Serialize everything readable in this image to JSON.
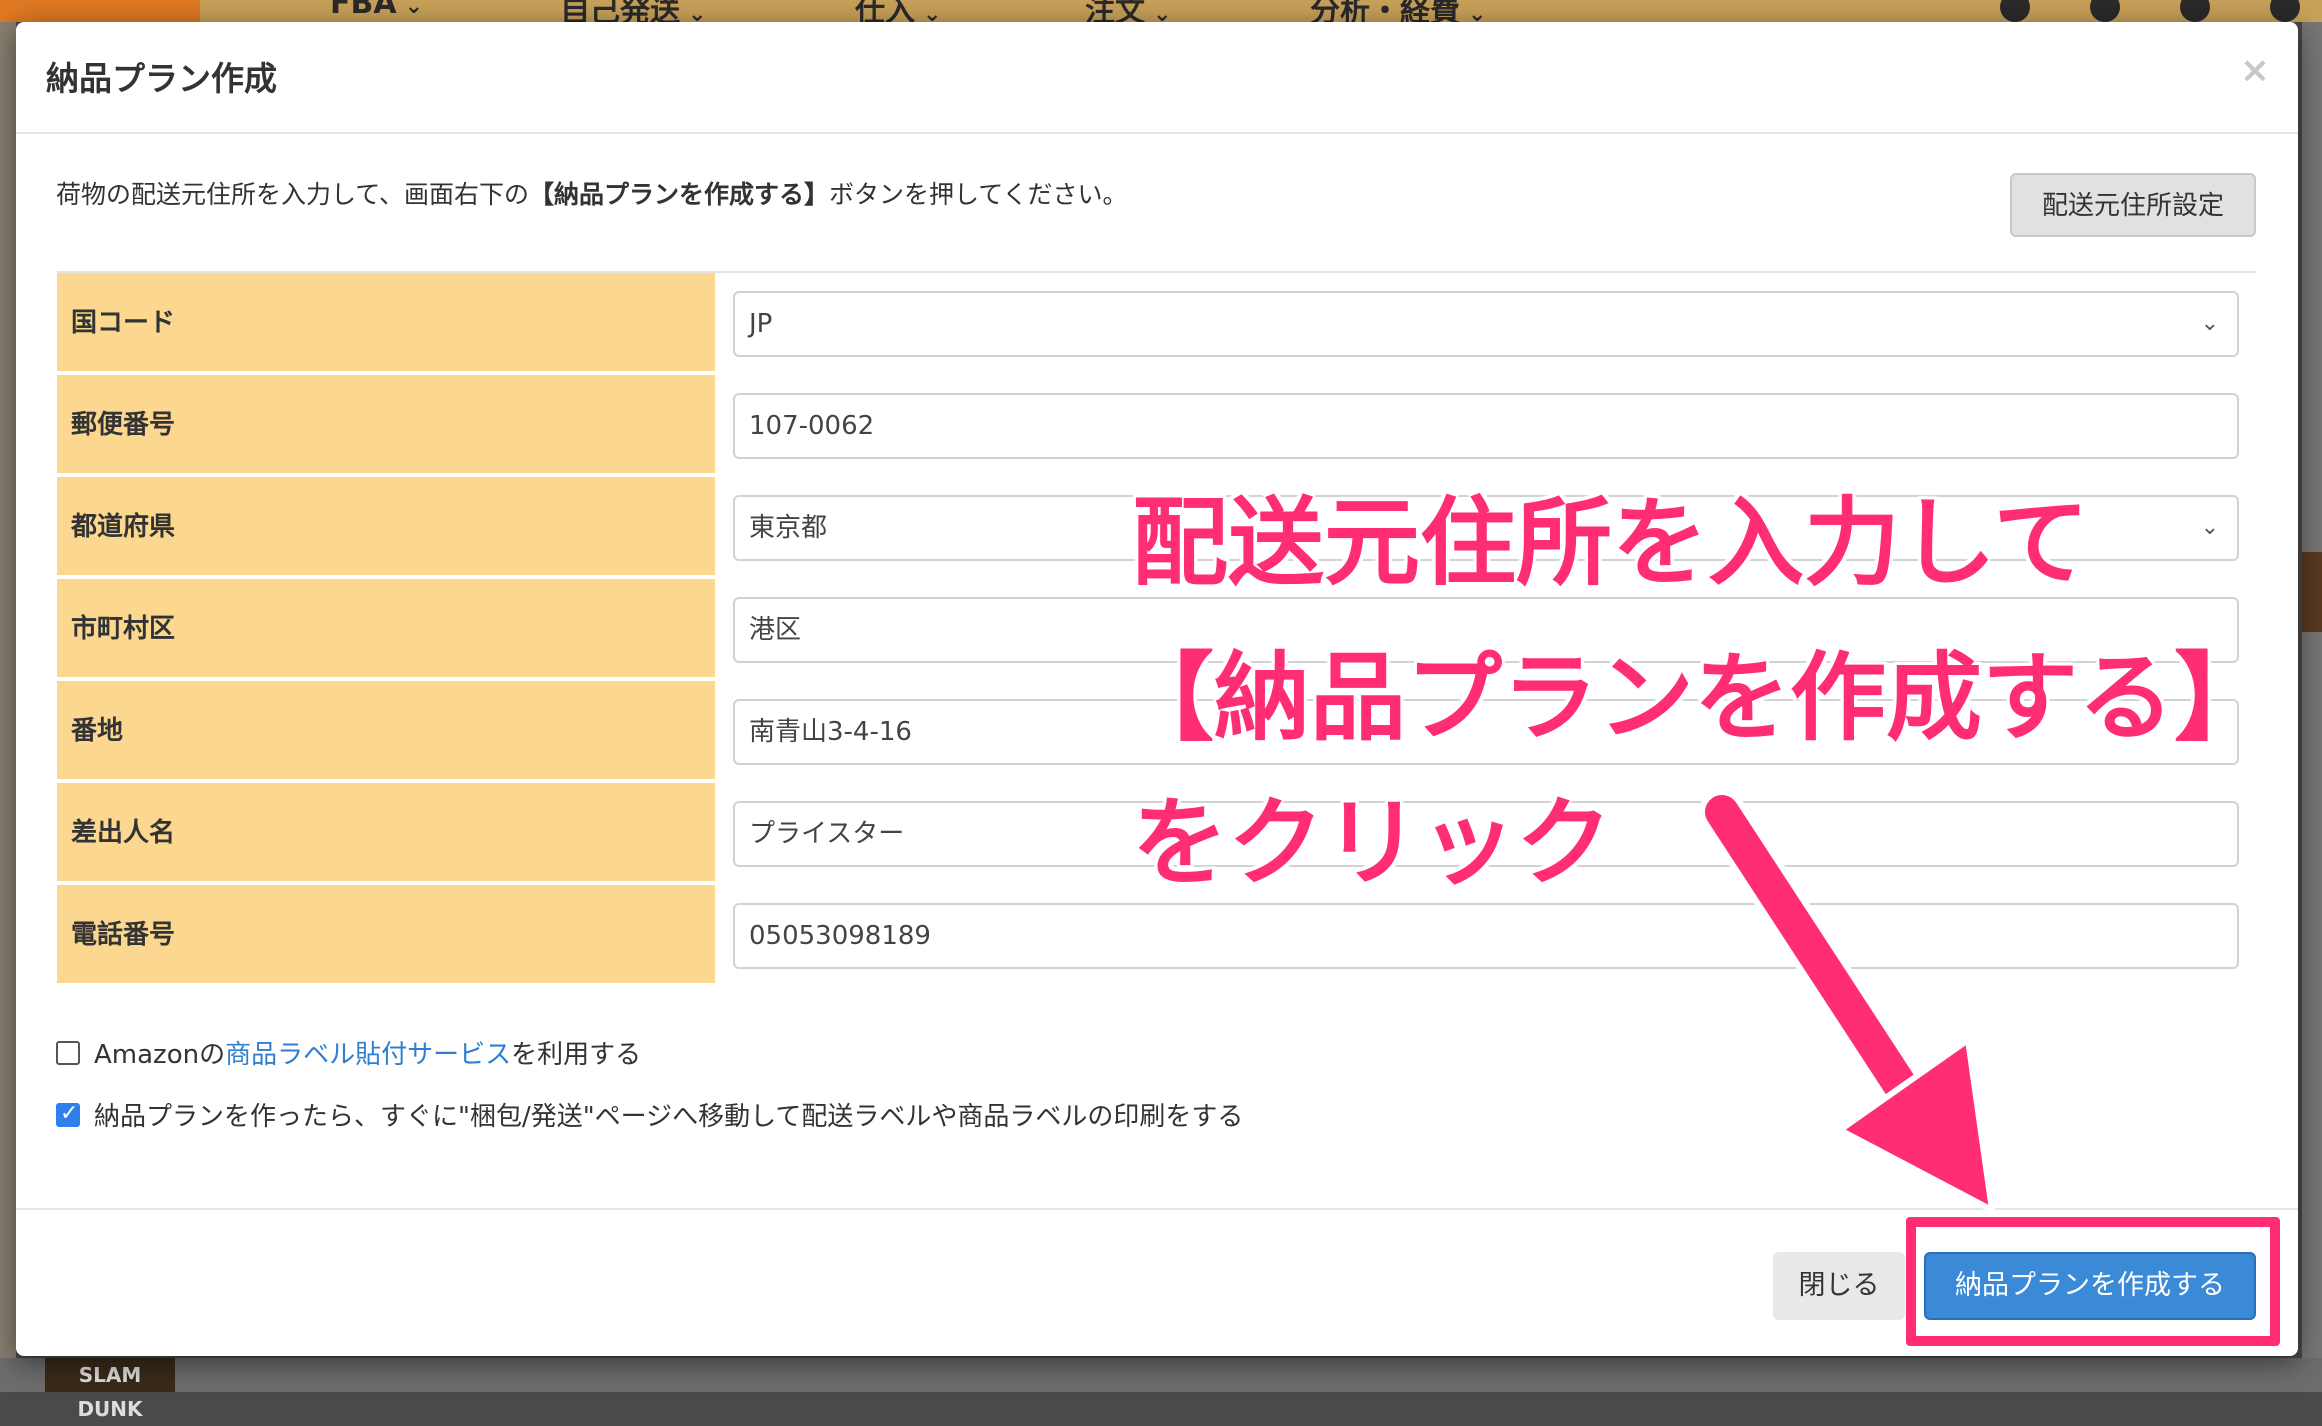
{
  "background": {
    "nav_items": [
      "FBA",
      "自己発送",
      "仕入",
      "注文",
      "分析・経費"
    ],
    "thumb_text": "SLAM DUNK"
  },
  "modal": {
    "title": "納品プラン作成",
    "close_symbol": "×",
    "instruction_prefix": "荷物の配送元住所を入力して、画面右下の",
    "instruction_bold": "【納品プランを作成する】",
    "instruction_suffix": "ボタンを押してください。",
    "address_settings_button": "配送元住所設定",
    "fields": [
      {
        "label": "国コード",
        "value": "JP",
        "type": "select"
      },
      {
        "label": "郵便番号",
        "value": "107-0062",
        "type": "input"
      },
      {
        "label": "都道府県",
        "value": "東京都",
        "type": "select"
      },
      {
        "label": "市町村区",
        "value": "港区",
        "type": "input"
      },
      {
        "label": "番地",
        "value": "南青山3-4-16",
        "type": "input"
      },
      {
        "label": "差出人名",
        "value": "プライスター",
        "type": "input"
      },
      {
        "label": "電話番号",
        "value": "05053098189",
        "type": "input"
      }
    ],
    "checkbox1": {
      "prefix": "Amazonの",
      "link": "商品ラベル貼付サービス",
      "suffix": "を利用する",
      "checked": false
    },
    "checkbox2": {
      "text": "納品プランを作ったら、すぐに\"梱包/発送\"ページへ移動して配送ラベルや商品ラベルの印刷をする",
      "checked": true
    },
    "close_button": "閉じる",
    "create_button": "納品プランを作成する"
  },
  "annotation": {
    "line1": "配送元住所を入力して",
    "line2": "【納品プランを作成する】",
    "line3": "をクリック",
    "color": "#ff2d74"
  }
}
